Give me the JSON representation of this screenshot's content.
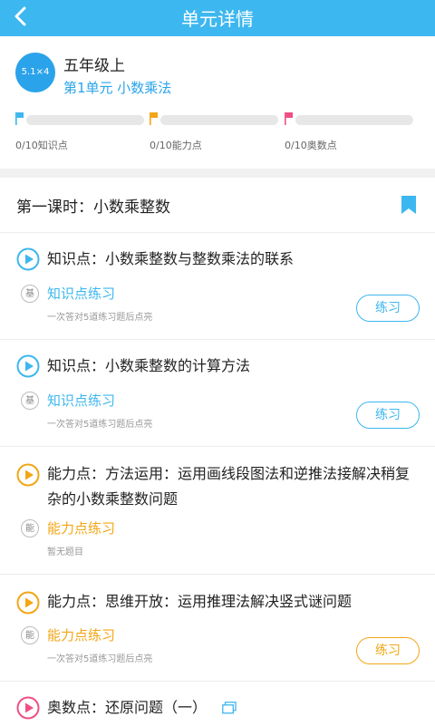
{
  "header": {
    "title": "单元详情"
  },
  "unit": {
    "icon_text": "5.1×4",
    "grade": "五年级上",
    "name": "第1单元  小数乘法"
  },
  "progress": [
    {
      "label": "0/10知识点",
      "value": 0,
      "flag_color": "#3db7ef"
    },
    {
      "label": "0/10能力点",
      "value": 0,
      "flag_color": "#f2a615"
    },
    {
      "label": "0/10奥数点",
      "value": 0,
      "flag_color": "#ef4f86"
    }
  ],
  "lesson": {
    "title": "第一课时：小数乘整数"
  },
  "items": [
    {
      "point": "知识点：小数乘整数与整数乘法的联系",
      "badge": "基",
      "practice": "知识点练习",
      "desc": "一次答对5道练习题后点亮",
      "button": "练习"
    },
    {
      "point": "知识点：小数乘整数的计算方法",
      "badge": "基",
      "practice": "知识点练习",
      "desc": "一次答对5道练习题后点亮",
      "button": "练习"
    },
    {
      "point": "能力点：方法运用：运用画线段图法和逆推法接解决稍复杂的小数乘整数问题",
      "badge": "能",
      "practice": "能力点练习",
      "desc": "暂无题目"
    },
    {
      "point": "能力点：思维开放：运用推理法解决竖式谜问题",
      "badge": "能",
      "practice": "能力点练习",
      "desc": "一次答对5道练习题后点亮",
      "button": "练习"
    },
    {
      "point": "奥数点：还原问题（一）"
    }
  ],
  "colors": {
    "accent": "#3db7ef",
    "ability": "#f2a615",
    "olympiad": "#ef4f86"
  }
}
